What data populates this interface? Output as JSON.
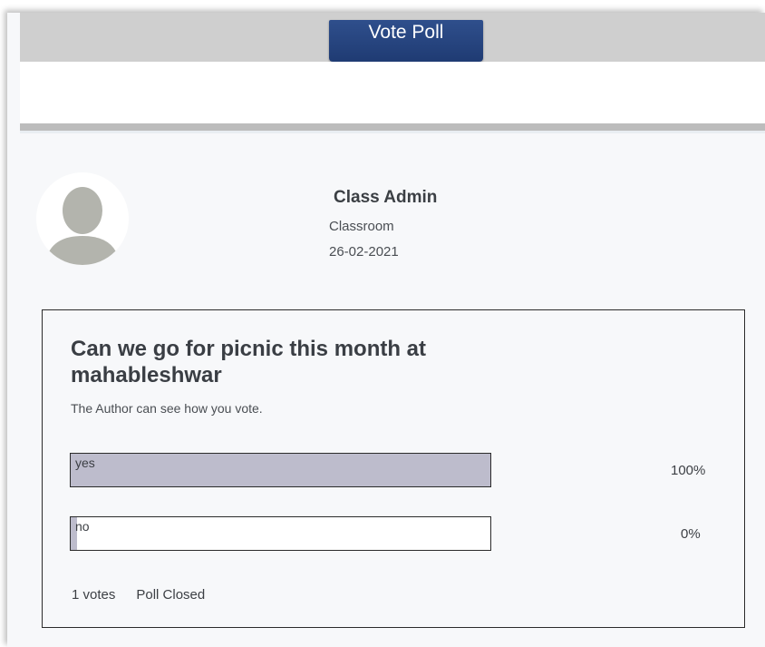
{
  "header": {
    "vote_button_label": "Vote Poll"
  },
  "post": {
    "author_name": "Class Admin",
    "author_group": "Classroom",
    "post_date": "26-02-2021"
  },
  "poll": {
    "question": "Can we go for picnic this month at mahableshwar",
    "visibility_note": "The Author can see how you vote.",
    "options": [
      {
        "label": "yes",
        "percent_text": "100%",
        "fraction": 1.0
      },
      {
        "label": "no",
        "percent_text": "0%",
        "fraction": 0.0
      }
    ],
    "votes_text": "1 votes",
    "status_text": "Poll Closed"
  },
  "colors": {
    "button_blue": "#1f3b73",
    "bar_fill": "#bdbccc",
    "text": "#3c3f44"
  },
  "icons": {
    "avatar": "default-user-avatar-icon"
  }
}
